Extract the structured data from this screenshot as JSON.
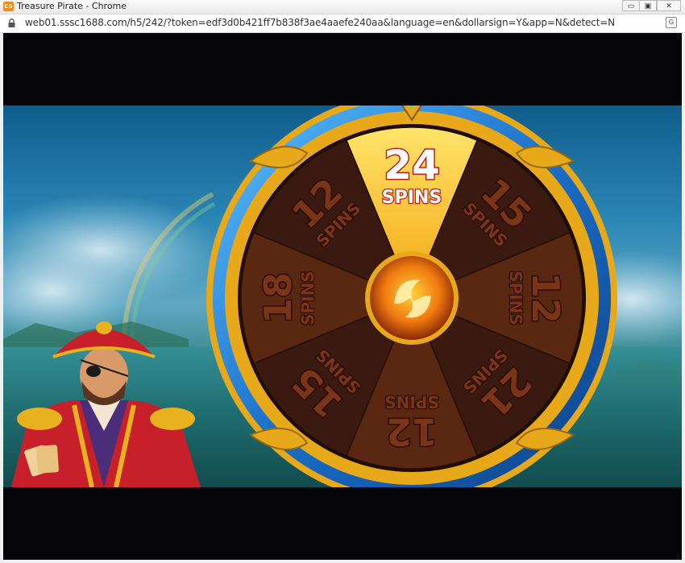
{
  "window": {
    "title": "Treasure Pirate - Chrome",
    "app_icon_text": "CS",
    "minimize_glyph": "▭",
    "maximize_glyph": "▣",
    "close_glyph": "✕"
  },
  "address_bar": {
    "url": "web01.sssc1688.com/h5/242/?token=edf3d0b421ff7b838f3ae4aaefe240aa&language=en&dollarsign=Y&app=N&detect=N",
    "translate_glyph": "G"
  },
  "game": {
    "spins_word": "SPINS",
    "wheel_segments": [
      {
        "value": "24",
        "label": "SPINS",
        "highlighted": true
      },
      {
        "value": "15",
        "label": "SPINS",
        "highlighted": false
      },
      {
        "value": "12",
        "label": "SPINS",
        "highlighted": false
      },
      {
        "value": "21",
        "label": "SPINS",
        "highlighted": false
      },
      {
        "value": "12",
        "label": "SPINS",
        "highlighted": false
      },
      {
        "value": "15",
        "label": "SPINS",
        "highlighted": false
      },
      {
        "value": "18",
        "label": "SPINS",
        "highlighted": false
      },
      {
        "value": "12",
        "label": "SPINS",
        "highlighted": false
      }
    ],
    "colors": {
      "highlight": "#ffcf2e",
      "segment_dark": "#3a1a10",
      "segment_mid": "#5a2710",
      "rim_blue": "#1d7fd6",
      "gold": "#e7a919"
    }
  }
}
